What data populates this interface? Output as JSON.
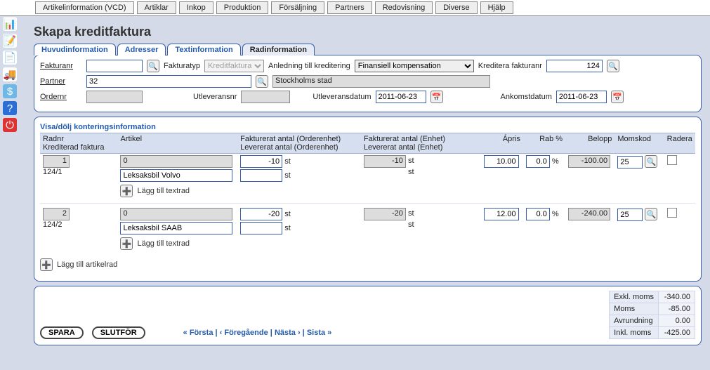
{
  "topnav": [
    "Artikelinformation (VCD)",
    "Artiklar",
    "Inkop",
    "Produktion",
    "Försäljning",
    "Partners",
    "Redovisning",
    "Diverse",
    "Hjälp"
  ],
  "title": "Skapa kreditfaktura",
  "page_tabs": [
    "Huvudinformation",
    "Adresser",
    "Textinformation",
    "Radinformation"
  ],
  "active_page_tab": 3,
  "header": {
    "fakturanr_label": "Fakturanr",
    "fakturanr": "",
    "fakturatyp_label": "Fakturatyp",
    "fakturatyp": "Kreditfaktura",
    "anledning_label": "Anledning till kreditering",
    "anledning": "Finansiell kompensation",
    "kreditera_label": "Kreditera fakturanr",
    "kreditera": "124",
    "partner_label": "Partner",
    "partner": "32",
    "partner_name": "Stockholms stad",
    "ordernr_label": "Ordernr",
    "ordernr": "",
    "utleveransnr_label": "Utleveransnr",
    "utleveransnr": "",
    "utleveransdatum_label": "Utleveransdatum",
    "utleveransdatum": "2011-06-23",
    "ankomstdatum_label": "Ankomstdatum",
    "ankomstdatum": "2011-06-23"
  },
  "section_toggle": "Visa/dölj konteringsinformation",
  "columns": {
    "radnr": "Radnr",
    "krediterad": "Krediterad faktura",
    "artikel": "Artikel",
    "fakt_order": "Fakturerat antal (Orderenhet)",
    "lev_order": "Levererat antal (Orderenhet)",
    "fakt_enhet": "Fakturerat antal (Enhet)",
    "lev_enhet": "Levererat antal (Enhet)",
    "apris": "Ápris",
    "rab": "Rab %",
    "belopp": "Belopp",
    "momskod": "Momskod",
    "radera": "Radera"
  },
  "rows": [
    {
      "radnr": "1",
      "krediterad": "124/1",
      "artikel_code": "0",
      "artikel_name": "Leksaksbil Volvo",
      "fakt_order": "-10",
      "fakt_order_unit": "st",
      "lev_order": "",
      "lev_order_unit": "st",
      "fakt_enhet": "-10",
      "fakt_enhet_unit": "st",
      "lev_enhet": "",
      "lev_enhet_unit": "st",
      "apris": "10.00",
      "rab": "0.0",
      "belopp": "-100.00",
      "momskod": "25"
    },
    {
      "radnr": "2",
      "krediterad": "124/2",
      "artikel_code": "0",
      "artikel_name": "Leksaksbil SAAB",
      "fakt_order": "-20",
      "fakt_order_unit": "st",
      "lev_order": "",
      "lev_order_unit": "st",
      "fakt_enhet": "-20",
      "fakt_enhet_unit": "st",
      "lev_enhet": "",
      "lev_enhet_unit": "st",
      "apris": "12.00",
      "rab": "0.0",
      "belopp": "-240.00",
      "momskod": "25"
    }
  ],
  "add_textrow": "Lägg till textrad",
  "add_artikelrad": "Lägg till artikelrad",
  "footer": {
    "spara": "SPARA",
    "slutfor": "SLUTFÖR",
    "first": "« Första",
    "prev": "‹ Föregående",
    "next": "Nästa ›",
    "last": "Sista »"
  },
  "totals": {
    "exkl_label": "Exkl. moms",
    "exkl": "-340.00",
    "moms_label": "Moms",
    "moms": "-85.00",
    "avr_label": "Avrundning",
    "avr": "0.00",
    "inkl_label": "Inkl. moms",
    "inkl": "-425.00"
  },
  "sideicons": [
    {
      "name": "chart-icon",
      "glyph": "📊",
      "bg": "#fff"
    },
    {
      "name": "note-icon",
      "glyph": "📝",
      "bg": "#fff"
    },
    {
      "name": "doc-icon",
      "glyph": "📄",
      "bg": "#fff"
    },
    {
      "name": "truck-icon",
      "glyph": "🚚",
      "bg": "#fff"
    },
    {
      "name": "money-icon",
      "glyph": "$",
      "bg": "#6fb8e6"
    },
    {
      "name": "help-icon",
      "glyph": "?",
      "bg": "#2b6fd6"
    },
    {
      "name": "power-icon",
      "glyph": "⏻",
      "bg": "#d33"
    }
  ]
}
